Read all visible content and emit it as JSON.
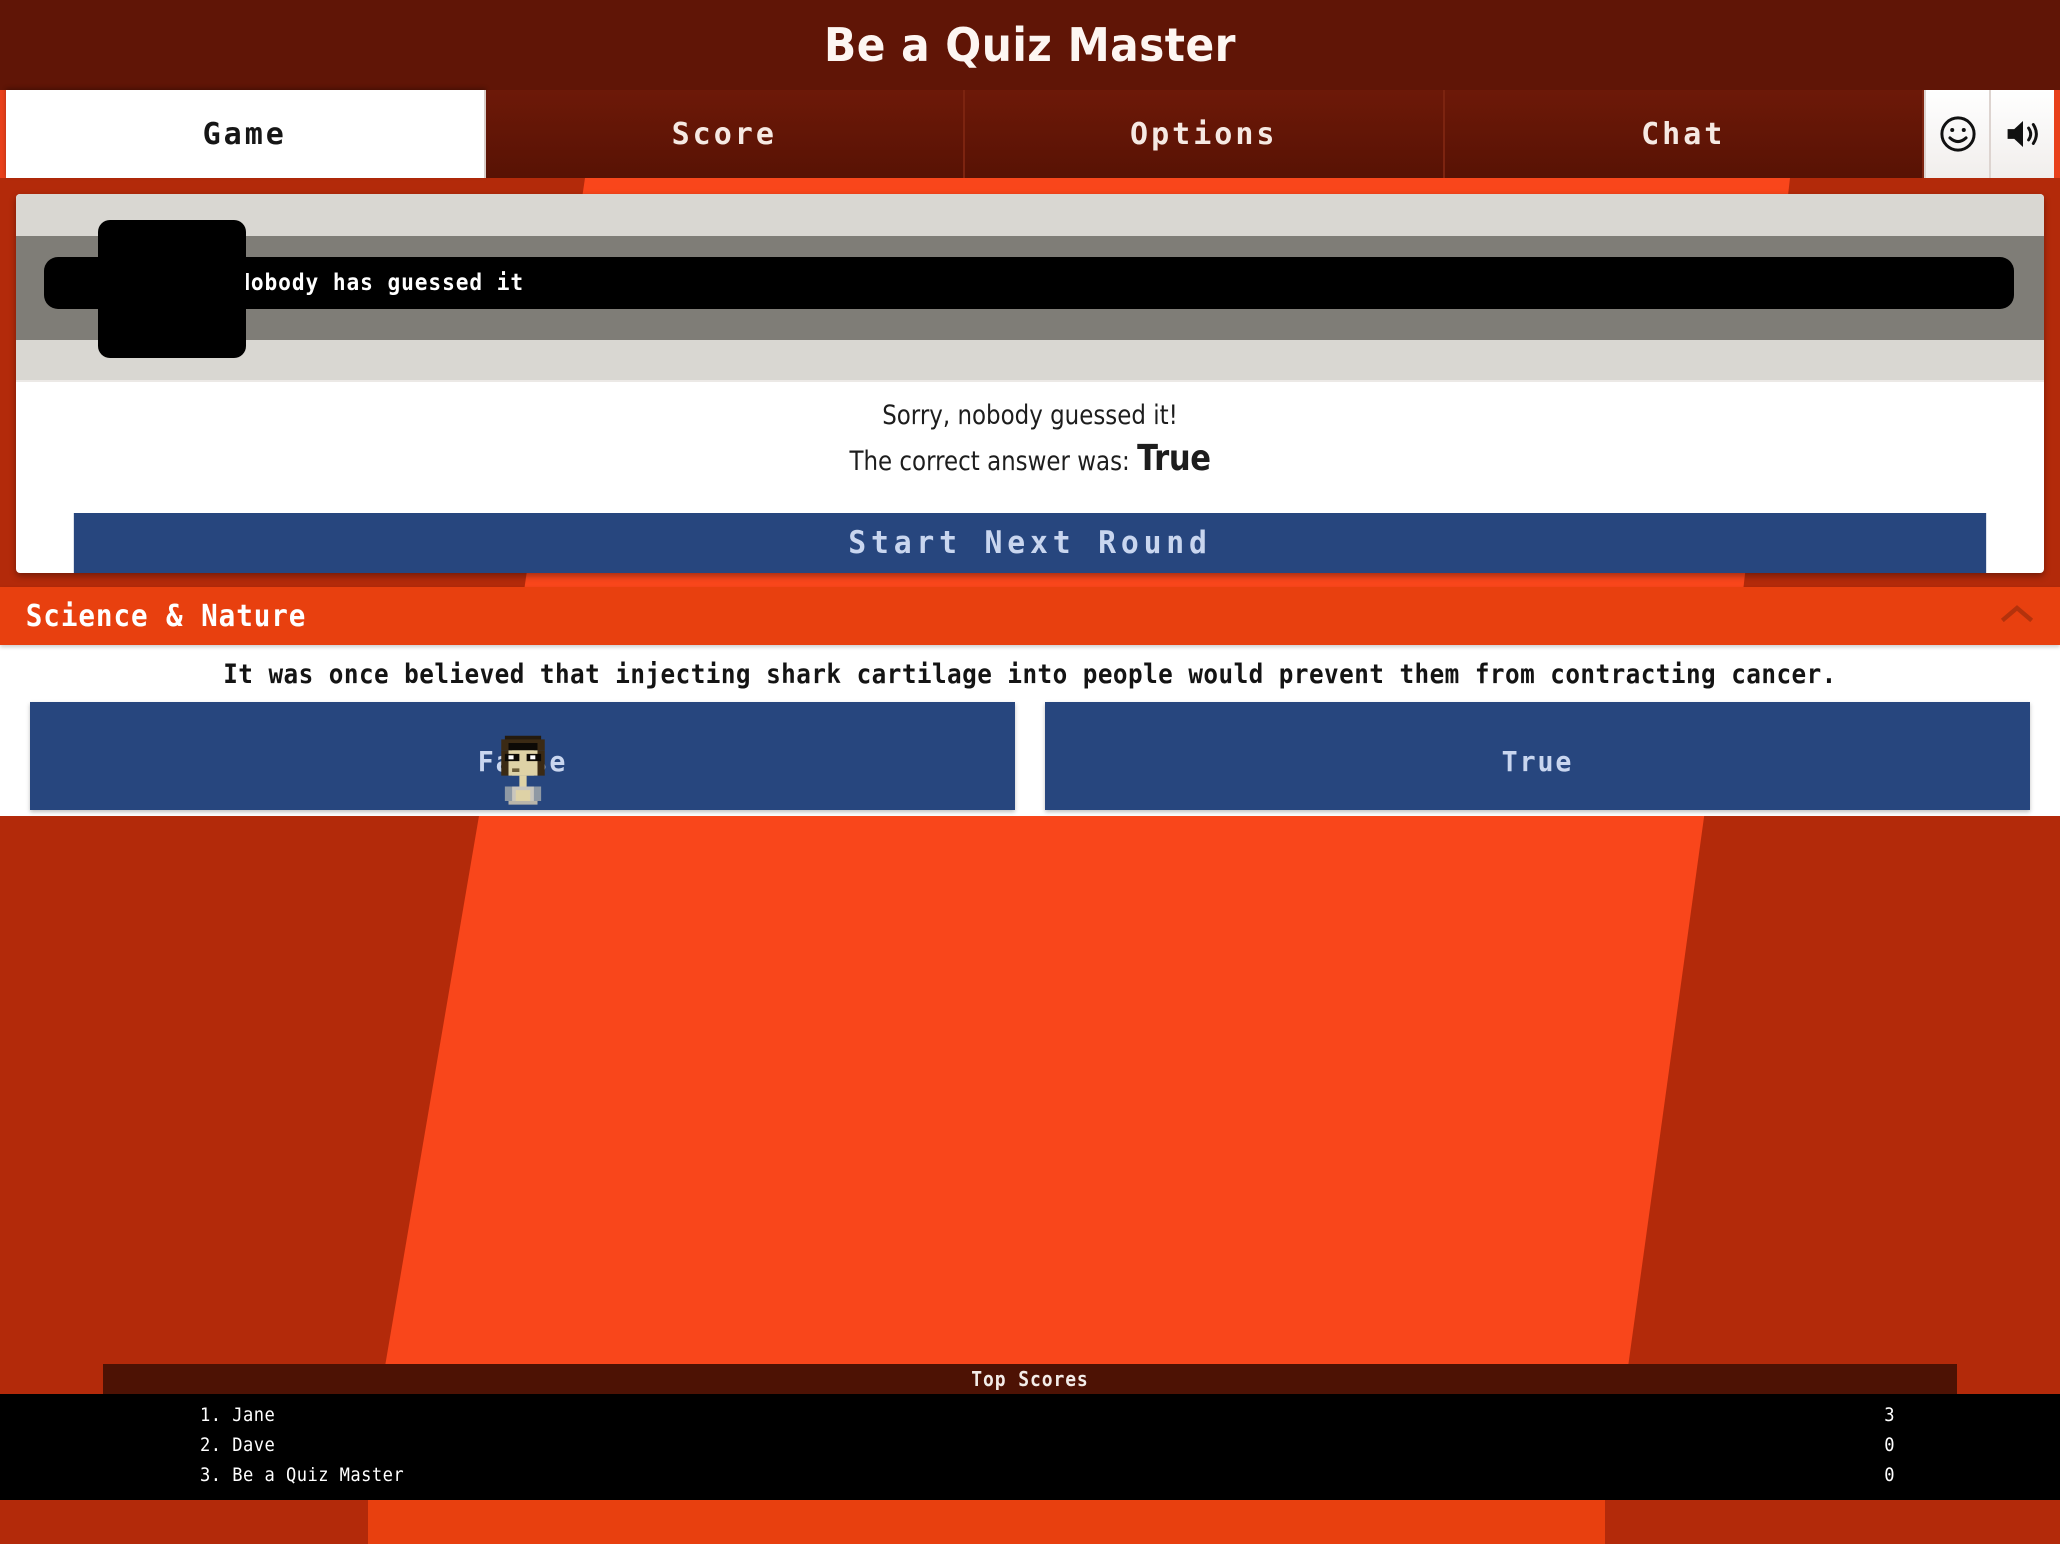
{
  "app": {
    "title": "Be a Quiz Master",
    "colors": {
      "header_bg": "#601506",
      "accent_orange": "#e8400f",
      "bright_orange": "#f9461b",
      "dark_red": "#b32a0a",
      "button_blue": "#27467e",
      "button_blue_text": "#c9d6ef"
    }
  },
  "tabs": [
    {
      "label": "Game",
      "active": true
    },
    {
      "label": "Score",
      "active": false
    },
    {
      "label": "Options",
      "active": false
    },
    {
      "label": "Chat",
      "active": false
    }
  ],
  "tab_icons": [
    {
      "name": "smiley-icon",
      "glyph": "smiley"
    },
    {
      "name": "volume-icon",
      "glyph": "speaker"
    }
  ],
  "game": {
    "guess_status": "Nobody has guessed it",
    "reveal_line1": "Sorry, nobody guessed it!",
    "reveal_prefix": "The correct answer was:",
    "reveal_answer": "True",
    "next_round_label": "Start Next Round"
  },
  "question": {
    "category": "Science & Nature",
    "collapse_icon": "chevron-up-icon",
    "text": "It was once believed that injecting shark cartilage into people would prevent them from contracting cancer.",
    "answers": [
      {
        "label": "False",
        "has_player_sprite": true
      },
      {
        "label": "True",
        "has_player_sprite": false
      }
    ]
  },
  "top_scores": {
    "heading": "Top Scores",
    "rows": [
      {
        "name": "1. Jane",
        "score": "3"
      },
      {
        "name": "2. Dave",
        "score": "0"
      },
      {
        "name": "3. Be a Quiz Master",
        "score": "0"
      }
    ]
  }
}
